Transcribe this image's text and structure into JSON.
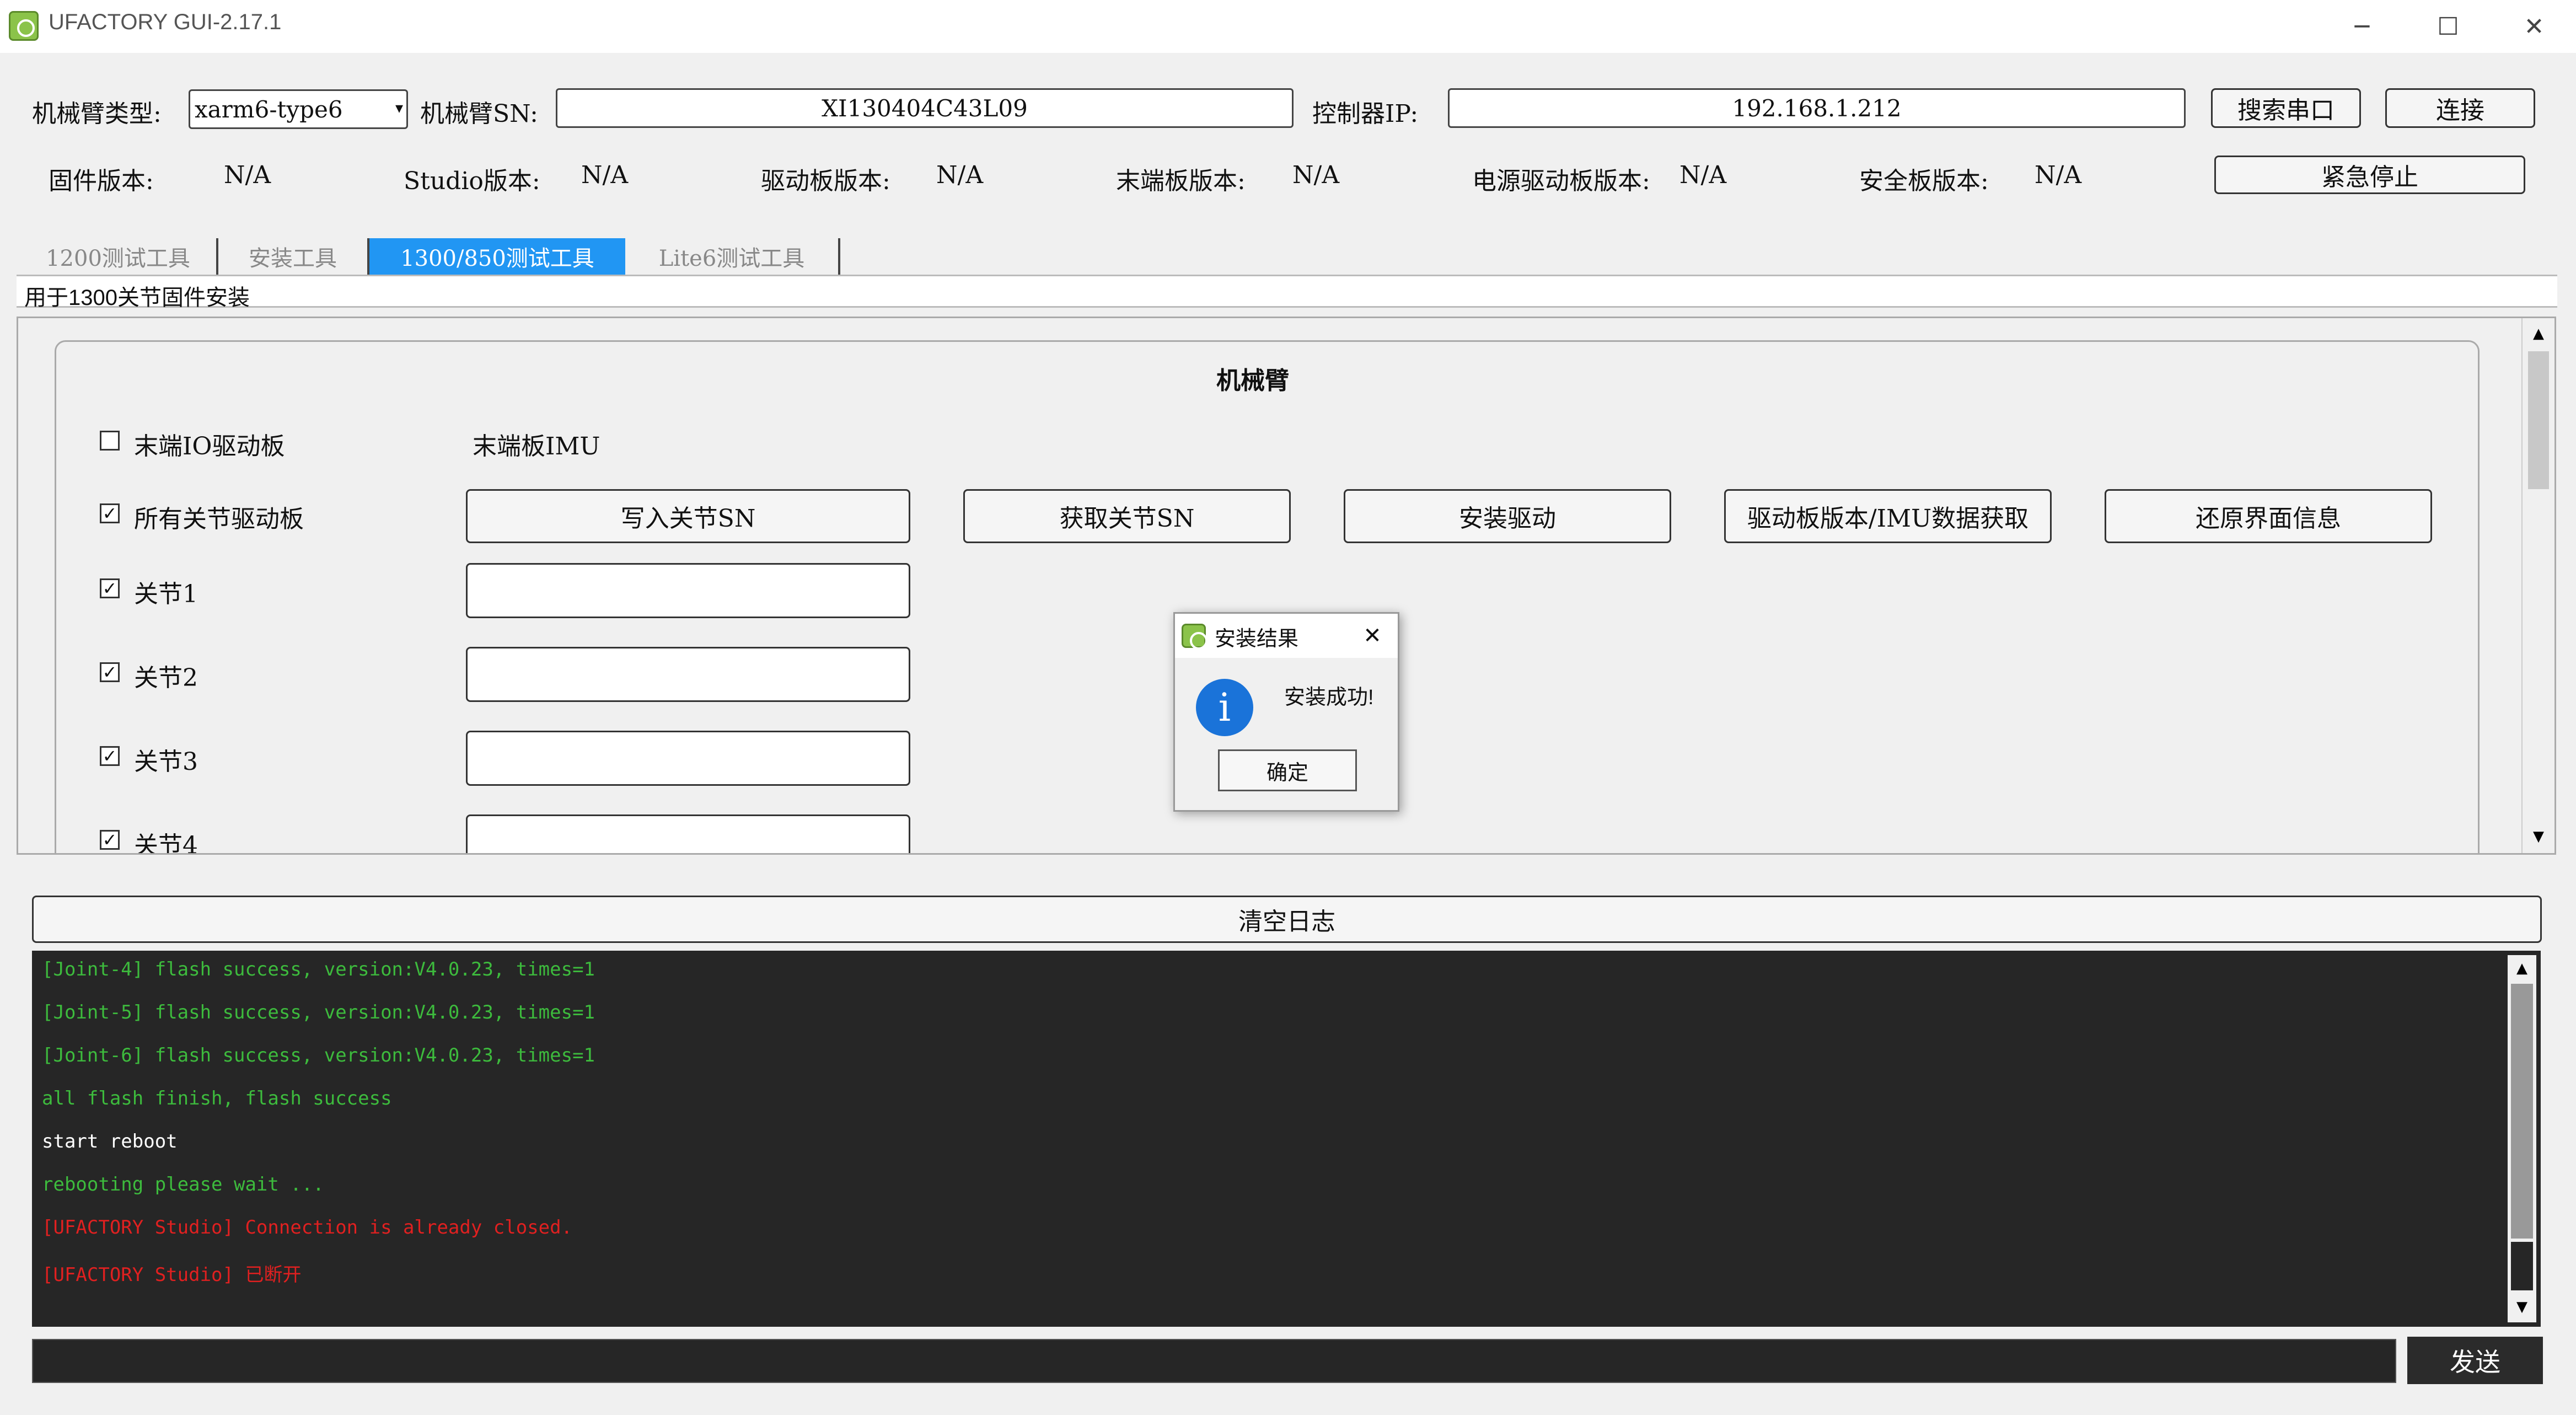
{
  "window": {
    "title": "UFACTORY GUI-2.17.1",
    "minimize": "─",
    "maximize": "☐",
    "close": "✕"
  },
  "header": {
    "arm_type_label": "机械臂类型:",
    "arm_type_value": "xarm6-type6",
    "arm_sn_label": "机械臂SN:",
    "arm_sn_value": "XI130404C43L09",
    "controller_ip_label": "控制器IP:",
    "controller_ip_value": "192.168.1.212",
    "search_port_button": "搜索串口",
    "connect_button": "连接"
  },
  "versions": {
    "firmware_label": "固件版本:",
    "firmware_value": "N/A",
    "studio_label": "Studio版本:",
    "studio_value": "N/A",
    "driver_label": "驱动板版本:",
    "driver_value": "N/A",
    "end_label": "末端板版本:",
    "end_value": "N/A",
    "power_label": "电源驱动板版本:",
    "power_value": "N/A",
    "safety_label": "安全板版本:",
    "safety_value": "N/A",
    "emergency_stop_button": "紧急停止"
  },
  "tabs": [
    "1200测试工具",
    "安装工具",
    "1300/850测试工具",
    "Lite6测试工具"
  ],
  "active_tab": "1300/850测试工具",
  "tab_description": "用于1300关节固件安装",
  "panel": {
    "group_title": "机械臂",
    "end_io_label": "末端IO驱动板",
    "end_io_checked": false,
    "end_imu_label": "末端板IMU",
    "all_joints_label": "所有关节驱动板",
    "all_joints_checked": true,
    "buttons": {
      "write_sn": "写入关节SN",
      "get_sn": "获取关节SN",
      "install_driver": "安装驱动",
      "version_imu": "驱动板版本/IMU数据获取",
      "restore_ui": "还原界面信息"
    },
    "joints": [
      {
        "label": "关节1",
        "checked": true,
        "value": ""
      },
      {
        "label": "关节2",
        "checked": true,
        "value": ""
      },
      {
        "label": "关节3",
        "checked": true,
        "value": ""
      },
      {
        "label": "关节4",
        "checked": true,
        "value": ""
      }
    ]
  },
  "dialog": {
    "title": "安装结果",
    "message": "安装成功!",
    "ok_button": "确定",
    "icon": "info-icon",
    "close": "✕"
  },
  "log": {
    "clear_button": "清空日志",
    "lines": [
      {
        "text": "[Joint-4] flash success, version:V4.0.23, times=1",
        "color": "#3dbb3d"
      },
      {
        "text": "[Joint-5] flash success, version:V4.0.23, times=1",
        "color": "#3dbb3d"
      },
      {
        "text": "[Joint-6] flash success, version:V4.0.23, times=1",
        "color": "#3dbb3d"
      },
      {
        "text": "all flash finish, flash success",
        "color": "#3dbb3d"
      },
      {
        "text": "start reboot",
        "color": "#ffffff"
      },
      {
        "text": "rebooting please wait ...",
        "color": "#3dbb3d"
      },
      {
        "text": "[UFACTORY Studio] Connection is already closed.",
        "color": "#e02020"
      },
      {
        "text": "[UFACTORY Studio] 已断开",
        "color": "#e02020"
      }
    ]
  },
  "command": {
    "input_value": "",
    "send_button": "发送"
  },
  "colors": {
    "accent": "#2196f3",
    "log_bg": "#262626",
    "success": "#3dbb3d",
    "error": "#e02020"
  }
}
